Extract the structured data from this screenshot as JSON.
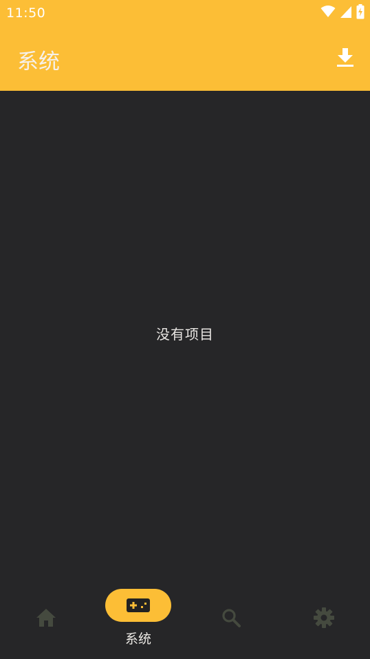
{
  "status_bar": {
    "time": "11:50",
    "icons": [
      "wifi-icon",
      "cell-signal-icon",
      "battery-charging-icon"
    ]
  },
  "toolbar": {
    "title": "系统",
    "action_icon": "download-icon"
  },
  "content": {
    "empty_message": "没有项目"
  },
  "bottom_nav": {
    "items": [
      {
        "icon": "home-icon",
        "label": "",
        "active": false
      },
      {
        "icon": "gamepad-icon",
        "label": "系统",
        "active": true
      },
      {
        "icon": "search-icon",
        "label": "",
        "active": false
      },
      {
        "icon": "gear-icon",
        "label": "",
        "active": false
      }
    ]
  },
  "colors": {
    "accent": "#FCBE36",
    "background": "#262628",
    "inactive_icon": "#454A3F"
  }
}
